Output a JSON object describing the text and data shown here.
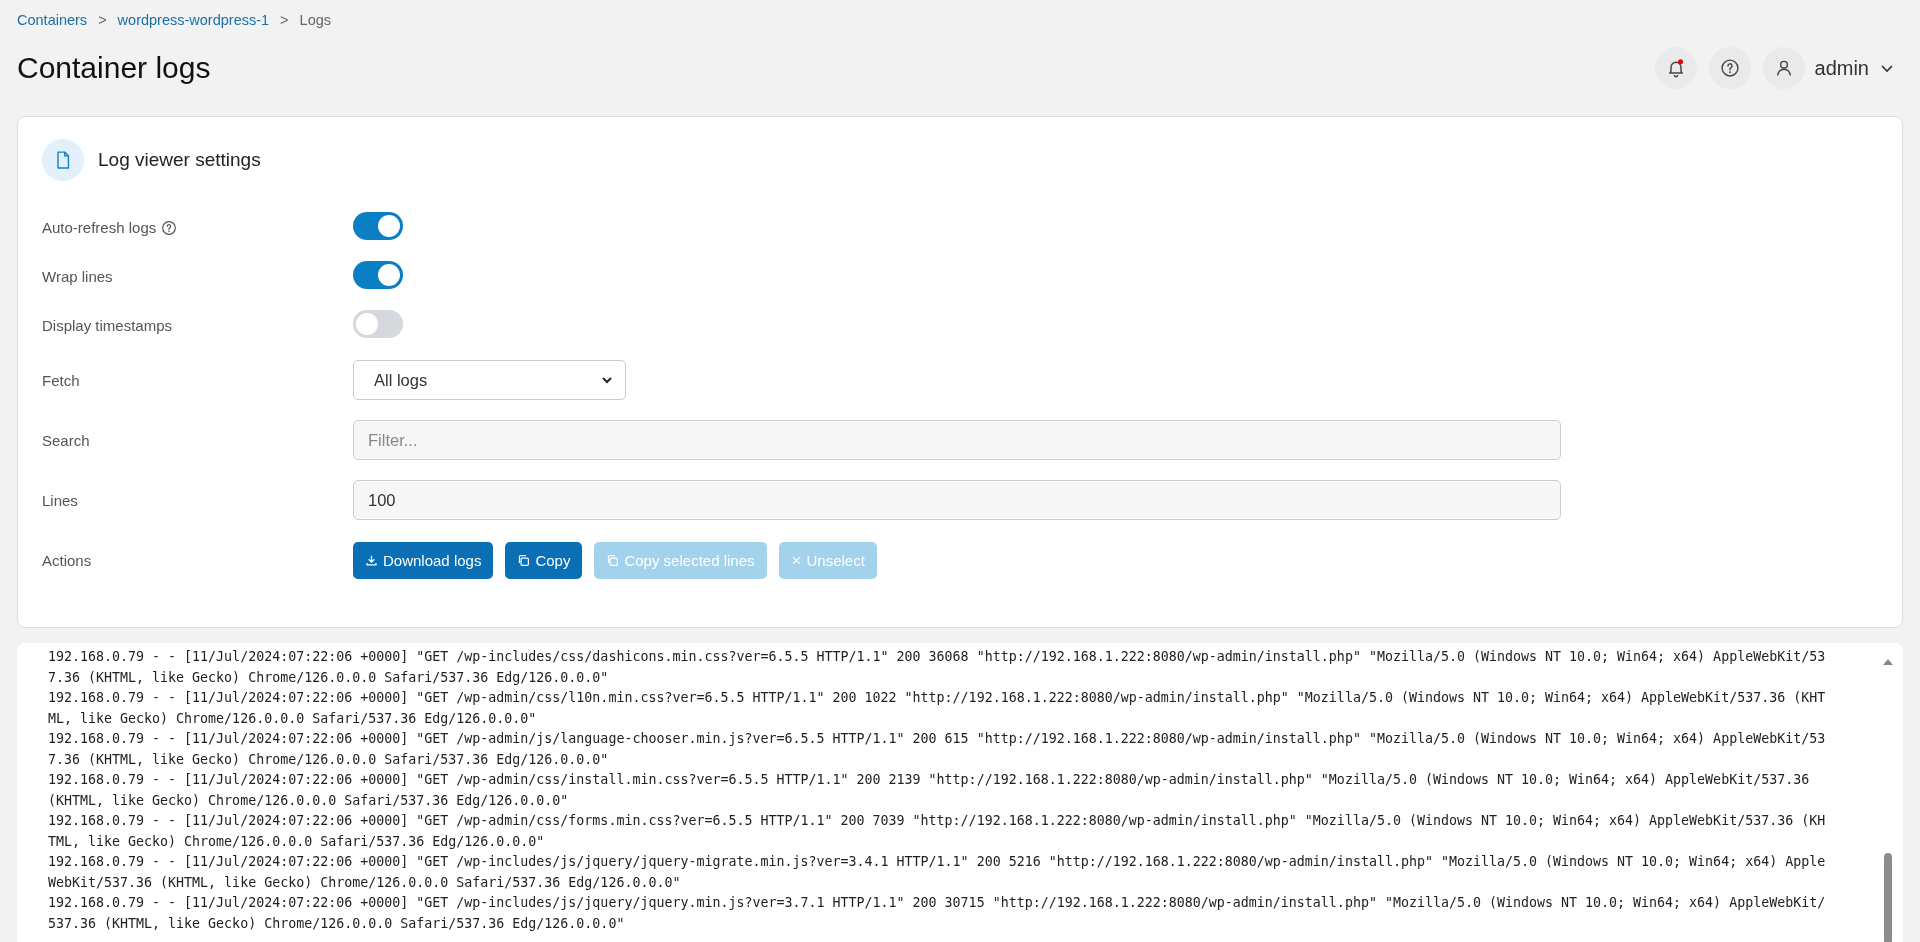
{
  "breadcrumbs": [
    {
      "label": "Containers",
      "link": true
    },
    {
      "separator": ">",
      "label": "wordpress-wordpress-1",
      "link": true
    },
    {
      "separator": ">",
      "label": "Logs",
      "link": false
    }
  ],
  "page_title": "Container logs",
  "header": {
    "notification": true,
    "user": "admin"
  },
  "settings": {
    "title": "Log viewer settings",
    "rows": [
      {
        "kind": "toggle",
        "label": "Auto-refresh logs",
        "help": true,
        "on": true
      },
      {
        "kind": "toggle",
        "label": "Wrap lines",
        "help": false,
        "on": true
      },
      {
        "kind": "toggle",
        "label": "Display timestamps",
        "help": false,
        "on": false
      },
      {
        "kind": "select",
        "label": "Fetch",
        "value": "All logs"
      },
      {
        "kind": "input",
        "label": "Search",
        "placeholder": "Filter..."
      },
      {
        "kind": "input",
        "label": "Lines",
        "value": "100"
      },
      {
        "kind": "actions",
        "label": "Actions",
        "buttons": [
          {
            "label": "Download logs",
            "disabled": false
          },
          {
            "label": "Copy",
            "disabled": false
          },
          {
            "label": "Copy selected lines",
            "disabled": true
          },
          {
            "label": "Unselect",
            "disabled": true
          }
        ]
      }
    ]
  },
  "logs": [
    "192.168.0.79 - - [11/Jul/2024:07:22:06 +0000] \"GET /wp-includes/css/dashicons.min.css?ver=6.5.5 HTTP/1.1\" 200 36068 \"http://192.168.1.222:8080/wp-admin/install.php\" \"Mozilla/5.0 (Windows NT 10.0; Win64; x64) AppleWebKit/537.36 (KHTML, like Gecko) Chrome/126.0.0.0 Safari/537.36 Edg/126.0.0.0\"",
    "192.168.0.79 - - [11/Jul/2024:07:22:06 +0000] \"GET /wp-admin/css/l10n.min.css?ver=6.5.5 HTTP/1.1\" 200 1022 \"http://192.168.1.222:8080/wp-admin/install.php\" \"Mozilla/5.0 (Windows NT 10.0; Win64; x64) AppleWebKit/537.36 (KHTML, like Gecko) Chrome/126.0.0.0 Safari/537.36 Edg/126.0.0.0\"",
    "192.168.0.79 - - [11/Jul/2024:07:22:06 +0000] \"GET /wp-admin/js/language-chooser.min.js?ver=6.5.5 HTTP/1.1\" 200 615 \"http://192.168.1.222:8080/wp-admin/install.php\" \"Mozilla/5.0 (Windows NT 10.0; Win64; x64) AppleWebKit/537.36 (KHTML, like Gecko) Chrome/126.0.0.0 Safari/537.36 Edg/126.0.0.0\"",
    "192.168.0.79 - - [11/Jul/2024:07:22:06 +0000] \"GET /wp-admin/css/install.min.css?ver=6.5.5 HTTP/1.1\" 200 2139 \"http://192.168.1.222:8080/wp-admin/install.php\" \"Mozilla/5.0 (Windows NT 10.0; Win64; x64) AppleWebKit/537.36 (KHTML, like Gecko) Chrome/126.0.0.0 Safari/537.36 Edg/126.0.0.0\"",
    "192.168.0.79 - - [11/Jul/2024:07:22:06 +0000] \"GET /wp-admin/css/forms.min.css?ver=6.5.5 HTTP/1.1\" 200 7039 \"http://192.168.1.222:8080/wp-admin/install.php\" \"Mozilla/5.0 (Windows NT 10.0; Win64; x64) AppleWebKit/537.36 (KHTML, like Gecko) Chrome/126.0.0.0 Safari/537.36 Edg/126.0.0.0\"",
    "192.168.0.79 - - [11/Jul/2024:07:22:06 +0000] \"GET /wp-includes/js/jquery/jquery-migrate.min.js?ver=3.4.1 HTTP/1.1\" 200 5216 \"http://192.168.1.222:8080/wp-admin/install.php\" \"Mozilla/5.0 (Windows NT 10.0; Win64; x64) AppleWebKit/537.36 (KHTML, like Gecko) Chrome/126.0.0.0 Safari/537.36 Edg/126.0.0.0\"",
    "192.168.0.79 - - [11/Jul/2024:07:22:06 +0000] \"GET /wp-includes/js/jquery/jquery.min.js?ver=3.7.1 HTTP/1.1\" 200 30715 \"http://192.168.1.222:8080/wp-admin/install.php\" \"Mozilla/5.0 (Windows NT 10.0; Win64; x64) AppleWebKit/537.36 (KHTML, like Gecko) Chrome/126.0.0.0 Safari/537.36 Edg/126.0.0.0\""
  ]
}
